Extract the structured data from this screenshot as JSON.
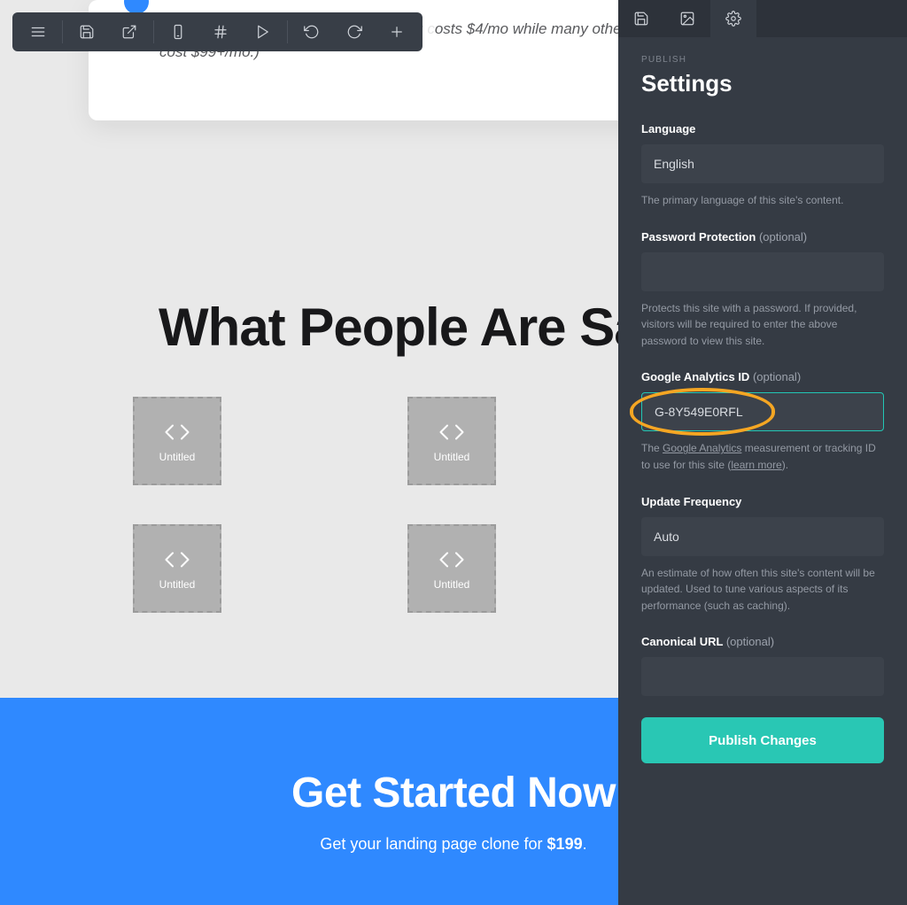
{
  "card": {
    "text_partial": "osts $4/mo while many othe",
    "text_tail": "cost $99+/mo.)"
  },
  "heading": "What People Are Saying",
  "embed_label": "Untitled",
  "cta": {
    "title": "Get Started Now",
    "subtitle_prefix": "Get your landing page clone for ",
    "price": "$199",
    "subtitle_suffix": "."
  },
  "sidebar": {
    "overline": "PUBLISH",
    "title": "Settings",
    "language": {
      "label": "Language",
      "value": "English",
      "helper": "The primary language of this site's content."
    },
    "password": {
      "label": "Password Protection",
      "optional": "(optional)",
      "helper": "Protects this site with a password. If provided, visitors will be required to enter the above password to view this site."
    },
    "analytics": {
      "label": "Google Analytics ID",
      "optional": "(optional)",
      "value": "G-8Y549E0RFL",
      "helper_prefix": "The ",
      "helper_link1": "Google Analytics",
      "helper_mid": " measurement or tracking ID to use for this site (",
      "helper_link2": "learn more",
      "helper_suffix": ")."
    },
    "update": {
      "label": "Update Frequency",
      "value": "Auto",
      "helper": "An estimate of how often this site's content will be updated. Used to tune various aspects of its performance (such as caching)."
    },
    "canonical": {
      "label": "Canonical URL",
      "optional": "(optional)"
    },
    "publish_button": "Publish Changes"
  }
}
